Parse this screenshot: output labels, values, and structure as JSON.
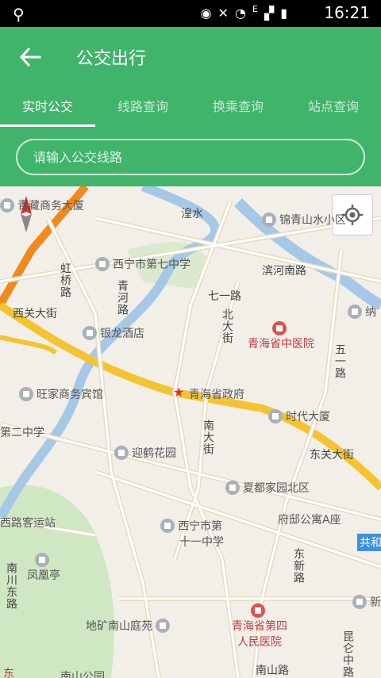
{
  "status_bar": {
    "time": "16:21",
    "network": "E",
    "icons": [
      "usb-icon",
      "eye-icon",
      "mute-icon",
      "wifi-icon",
      "signal-icon",
      "battery-icon"
    ]
  },
  "header": {
    "title": "公交出行",
    "back_icon": "arrow-left-icon"
  },
  "tabs": [
    {
      "label": "实时公交",
      "active": true
    },
    {
      "label": "线路查询",
      "active": false
    },
    {
      "label": "换乘查询",
      "active": false
    },
    {
      "label": "站点查询",
      "active": false
    }
  ],
  "search": {
    "placeholder": "请输入公交线路",
    "value": ""
  },
  "map": {
    "pois": [
      {
        "label": "青藏商务大厦",
        "type": "building"
      },
      {
        "label": "锦青山水小区",
        "type": "building"
      },
      {
        "label": "西宁市第七中学",
        "type": "school"
      },
      {
        "label": "纳",
        "type": "building"
      },
      {
        "label": "银龙酒店",
        "type": "hotel"
      },
      {
        "label": "青海省中医院",
        "type": "hospital"
      },
      {
        "label": "旺家商务宾馆",
        "type": "hotel"
      },
      {
        "label": "青海省政府",
        "type": "government"
      },
      {
        "label": "时代大厦",
        "type": "building"
      },
      {
        "label": "第二中学",
        "type": "school"
      },
      {
        "label": "迎鹤花园",
        "type": "residential"
      },
      {
        "label": "夏都家园北区",
        "type": "residential"
      },
      {
        "label": "府邸公寓A座",
        "type": "residential"
      },
      {
        "label": "西宁市第",
        "type": "school"
      },
      {
        "label": "十一中学",
        "type": "school"
      },
      {
        "label": "西路客运站",
        "type": "station"
      },
      {
        "label": "凤凰亭",
        "type": "scenic"
      },
      {
        "label": "新",
        "type": "building"
      },
      {
        "label": "地矿南山庭苑",
        "type": "residential"
      },
      {
        "label": "青海省第四",
        "type": "hospital"
      },
      {
        "label": "人民医院",
        "type": "hospital"
      },
      {
        "label": "南山公园",
        "type": "park"
      },
      {
        "label": "共和",
        "type": "road-sign"
      }
    ],
    "roads": [
      {
        "label": "湟水"
      },
      {
        "label": "滨河南路"
      },
      {
        "label": "七一路"
      },
      {
        "label": "北大街"
      },
      {
        "label": "五一路"
      },
      {
        "label": "西关大街"
      },
      {
        "label": "东关大街"
      },
      {
        "label": "南大街"
      },
      {
        "label": "东新路"
      },
      {
        "label": "昆仑中路"
      },
      {
        "label": "南山路"
      },
      {
        "label": "南川东路"
      },
      {
        "label": "虹桥路"
      },
      {
        "label": "青河路"
      },
      {
        "label": "东"
      }
    ],
    "controls": {
      "locate_icon": "locate-icon",
      "compass_icon": "compass-icon"
    }
  },
  "colors": {
    "primary": "#3fb46a",
    "map_bg": "#f2efe9",
    "road_major": "#f4c430",
    "road_arterial": "#f08a1c",
    "river": "#a6c8e6",
    "park": "#cfe8c3"
  }
}
